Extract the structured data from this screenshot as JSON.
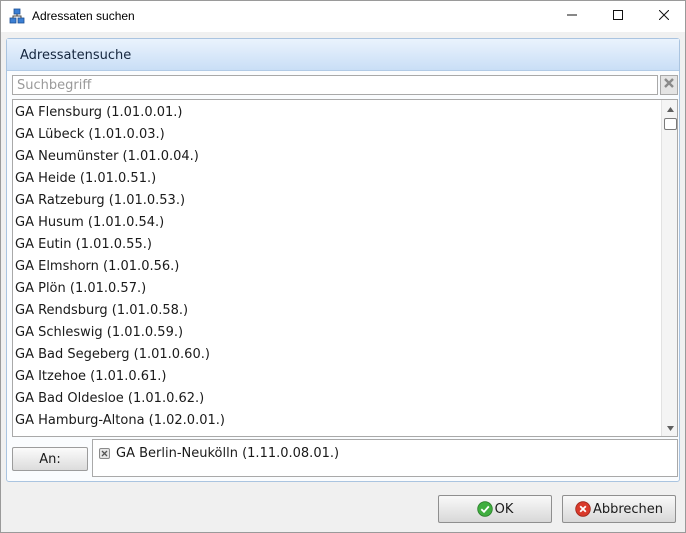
{
  "window": {
    "title": "Adressaten suchen",
    "icons": {
      "app": "network-nodes-icon",
      "minimize": "minimize-icon",
      "maximize": "maximize-icon",
      "close": "close-icon"
    }
  },
  "panel": {
    "title": "Adressatensuche"
  },
  "search": {
    "placeholder": "Suchbegriff",
    "value": "",
    "clear_icon": "clear-x-icon"
  },
  "results": [
    "GA Flensburg (1.01.0.01.)",
    "GA Lübeck (1.01.0.03.)",
    "GA Neumünster (1.01.0.04.)",
    "GA Heide (1.01.0.51.)",
    "GA Ratzeburg (1.01.0.53.)",
    "GA Husum (1.01.0.54.)",
    "GA Eutin (1.01.0.55.)",
    "GA Elmshorn (1.01.0.56.)",
    "GA Plön (1.01.0.57.)",
    "GA Rendsburg (1.01.0.58.)",
    "GA Schleswig (1.01.0.59.)",
    "GA Bad Segeberg (1.01.0.60.)",
    "GA Itzehoe (1.01.0.61.)",
    "GA Bad Oldesloe (1.01.0.62.)",
    "GA Hamburg-Altona (1.02.0.01.)"
  ],
  "recipients": {
    "to_label": "An:",
    "items": [
      "GA Berlin-Neukölln (1.11.0.08.01.)"
    ]
  },
  "footer": {
    "ok_label": "OK",
    "cancel_label": "Abbrechen",
    "ok_icon": "check-circle-icon",
    "cancel_icon": "x-circle-icon"
  },
  "colors": {
    "panel_header_top": "#eaf3fd",
    "panel_header_bottom": "#c9def6",
    "ok_green": "#3fae3f",
    "cancel_red": "#d93a2b"
  }
}
